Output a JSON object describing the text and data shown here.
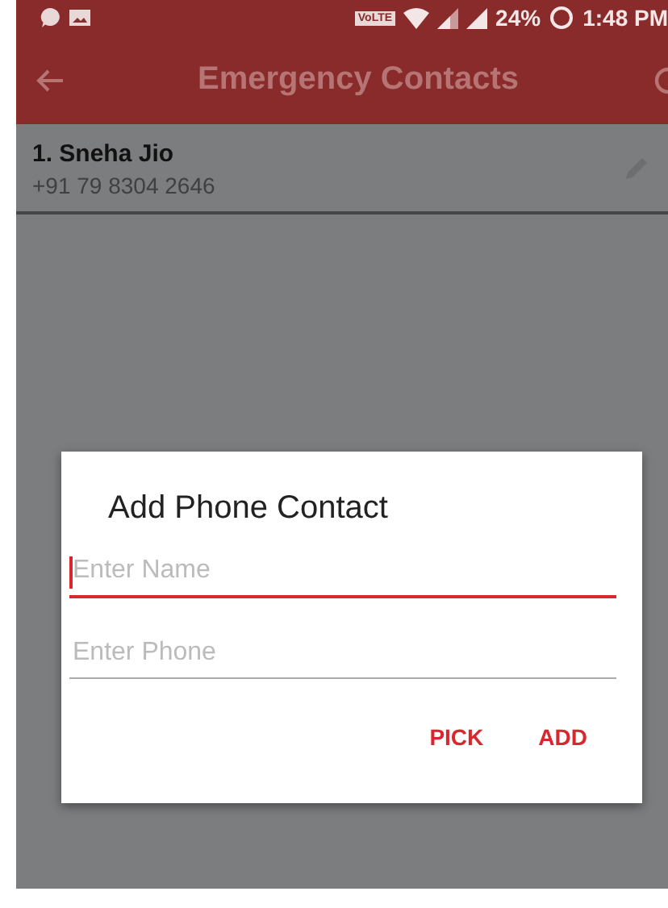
{
  "status_bar": {
    "volte": "VoLTE",
    "battery": "24%",
    "time": "1:48 PM"
  },
  "app_bar": {
    "title": "Emergency Contacts"
  },
  "contacts": [
    {
      "name": "1. Sneha Jio",
      "phone": "+91 79 8304 2646"
    }
  ],
  "dialog": {
    "title": "Add Phone Contact",
    "fields": [
      {
        "placeholder": "Enter Name",
        "focused": true
      },
      {
        "placeholder": "Enter Phone",
        "focused": false
      }
    ],
    "buttons": [
      "PICK",
      "ADD"
    ]
  }
}
